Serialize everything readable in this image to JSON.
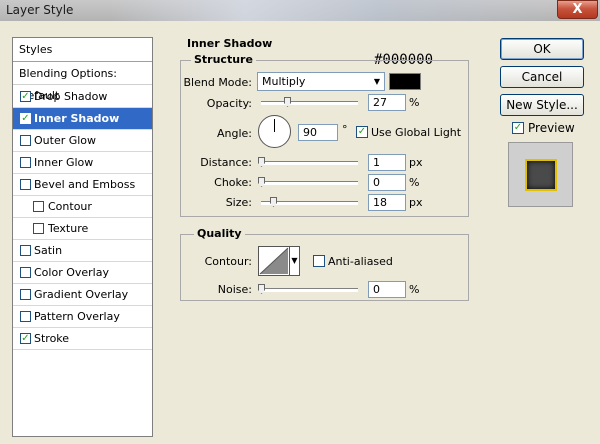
{
  "window": {
    "title": "Layer Style",
    "close_label": "X"
  },
  "styles_panel": {
    "header": "Styles",
    "blending_default": "Blending Options: Default",
    "items": [
      {
        "label": "Drop Shadow",
        "checked": true,
        "selected": false,
        "indent": false
      },
      {
        "label": "Inner Shadow",
        "checked": true,
        "selected": true,
        "indent": false
      },
      {
        "label": "Outer Glow",
        "checked": false,
        "selected": false,
        "indent": false
      },
      {
        "label": "Inner Glow",
        "checked": false,
        "selected": false,
        "indent": false
      },
      {
        "label": "Bevel and Emboss",
        "checked": false,
        "selected": false,
        "indent": false
      },
      {
        "label": "Contour",
        "checked": false,
        "selected": false,
        "indent": true
      },
      {
        "label": "Texture",
        "checked": false,
        "selected": false,
        "indent": true
      },
      {
        "label": "Satin",
        "checked": false,
        "selected": false,
        "indent": false
      },
      {
        "label": "Color Overlay",
        "checked": false,
        "selected": false,
        "indent": false
      },
      {
        "label": "Gradient Overlay",
        "checked": false,
        "selected": false,
        "indent": false
      },
      {
        "label": "Pattern Overlay",
        "checked": false,
        "selected": false,
        "indent": false
      },
      {
        "label": "Stroke",
        "checked": true,
        "selected": false,
        "indent": false
      }
    ]
  },
  "inner_shadow": {
    "title": "Inner Shadow",
    "color_annotation": "#000000",
    "structure": {
      "title": "Structure",
      "blend_mode_label": "Blend Mode:",
      "blend_mode_value": "Multiply",
      "shadow_color": "#000000",
      "opacity_label": "Opacity:",
      "opacity_value": "27",
      "opacity_level": 27,
      "opacity_unit": "%",
      "angle_label": "Angle:",
      "angle_value": "90",
      "angle_unit": "°",
      "use_global_light_label": "Use Global Light",
      "use_global_light_checked": true,
      "distance_label": "Distance:",
      "distance_value": "1",
      "distance_unit": "px",
      "choke_label": "Choke:",
      "choke_value": "0",
      "choke_unit": "%",
      "size_label": "Size:",
      "size_value": "18",
      "size_unit": "px"
    },
    "quality": {
      "title": "Quality",
      "contour_label": "Contour:",
      "anti_aliased_label": "Anti-aliased",
      "anti_aliased_checked": false,
      "noise_label": "Noise:",
      "noise_value": "0",
      "noise_unit": "%"
    }
  },
  "buttons": {
    "ok": "OK",
    "cancel": "Cancel",
    "new_style": "New Style..."
  },
  "preview": {
    "label": "Preview",
    "checked": true
  },
  "colors": {
    "selection": "#3169c6",
    "dialog_bg": "#ece9d8",
    "stroke_yellow": "#e0c000"
  }
}
